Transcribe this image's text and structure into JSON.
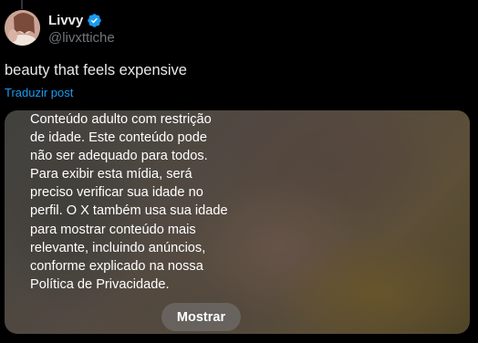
{
  "tweet": {
    "author": {
      "display_name": "Livvy",
      "handle": "@livxttiche",
      "verified": true,
      "verified_color": "#1d9bf0"
    },
    "text": "beauty that feels expensive",
    "translate_label": "Traduzir post"
  },
  "media": {
    "sensitive_warning": "Conteúdo adulto com restrição\nde idade. Este conteúdo pode\nnão ser adequado para todos.\nPara exibir esta mídia, será\npreciso verificar sua idade no\nperfil. O X também usa sua idade\npara mostrar conteúdo mais\nrelevante, incluindo anúncios,\nconforme explicado na nossa\nPolítica de Privacidade.",
    "show_button_label": "Mostrar"
  },
  "colors": {
    "background": "#000000",
    "text_primary": "#e7e9ea",
    "text_secondary": "#71767b",
    "link": "#1d9bf0"
  }
}
